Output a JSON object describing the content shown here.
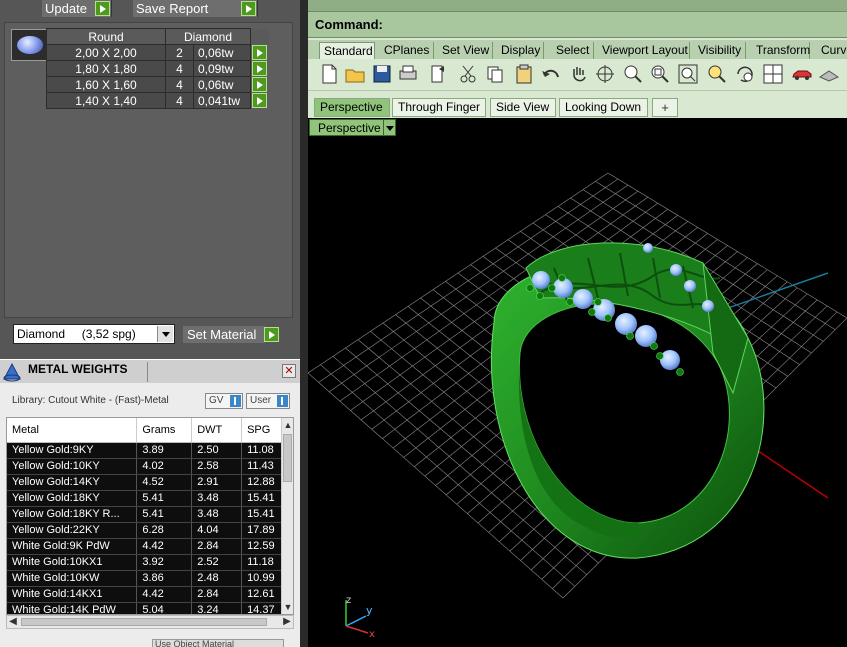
{
  "left_panel": {
    "update_label": "Update",
    "save_report_label": "Save Report",
    "stone_table": {
      "headers": [
        "Round",
        "Diamond"
      ],
      "rows": [
        {
          "size": "2,00 X 2,00",
          "qty": "2",
          "weight": "0,06tw"
        },
        {
          "size": "1,80 X 1,80",
          "qty": "4",
          "weight": "0,09tw"
        },
        {
          "size": "1,60 X 1,60",
          "qty": "4",
          "weight": "0,06tw"
        },
        {
          "size": "1,40 X 1,40",
          "qty": "4",
          "weight": "0,041tw"
        }
      ]
    },
    "material_select": "Diamond     (3,52 spg)",
    "set_material_label": "Set Material"
  },
  "metal_weights": {
    "title": "METAL WEIGHTS",
    "library": "Library: Cutout White - (Fast)-Metal",
    "toggle_gv": "GV",
    "toggle_user": "User",
    "columns": [
      "Metal",
      "Grams",
      "DWT",
      "SPG"
    ],
    "rows": [
      [
        "Yellow Gold:9KY",
        "3.89",
        "2.50",
        "11.08"
      ],
      [
        "Yellow Gold:10KY",
        "4.02",
        "2.58",
        "11.43"
      ],
      [
        "Yellow Gold:14KY",
        "4.52",
        "2.91",
        "12.88"
      ],
      [
        "Yellow Gold:18KY",
        "5.41",
        "3.48",
        "15.41"
      ],
      [
        "Yellow Gold:18KY R...",
        "5.41",
        "3.48",
        "15.41"
      ],
      [
        "Yellow Gold:22KY",
        "6.28",
        "4.04",
        "17.89"
      ],
      [
        "White Gold:9K PdW",
        "4.42",
        "2.84",
        "12.59"
      ],
      [
        "White Gold:10KX1",
        "3.92",
        "2.52",
        "11.18"
      ],
      [
        "White Gold:10KW",
        "3.86",
        "2.48",
        "10.99"
      ],
      [
        "White Gold:14KX1",
        "4.42",
        "2.84",
        "12.61"
      ],
      [
        "White Gold:14K PdW",
        "5.04",
        "3.24",
        "14.37"
      ]
    ],
    "bottom_cut_label": "Use Object Material"
  },
  "command": {
    "label": "Command:"
  },
  "toolbar_tabs": [
    "Standard",
    "CPlanes",
    "Set View",
    "Display",
    "Select",
    "Viewport Layout",
    "Visibility",
    "Transform",
    "Curve"
  ],
  "toolbar_icons": [
    "new-file-icon",
    "open-folder-icon",
    "save-icon",
    "print-icon",
    "import-icon",
    "cut-icon",
    "copy-icon",
    "paste-icon",
    "undo-icon",
    "pan-hand-icon",
    "rotate-view-icon",
    "zoom-icon",
    "zoom-window-icon",
    "zoom-extents-icon",
    "zoom-selected-icon",
    "rotate-camera-icon",
    "four-viewports-icon",
    "car-icon",
    "plane-icon"
  ],
  "viewport_tabs": [
    "Perspective",
    "Through Finger",
    "Side View",
    "Looking Down"
  ],
  "viewport": {
    "label": "Perspective",
    "axis_x": "x",
    "axis_y": "y",
    "axis_z": "z"
  },
  "colors": {
    "ring_green": "#1f8a1f",
    "stone_blue": "#9ec3ff",
    "grid": "#8a8a8a",
    "accent_green": "#4d9a1e"
  }
}
